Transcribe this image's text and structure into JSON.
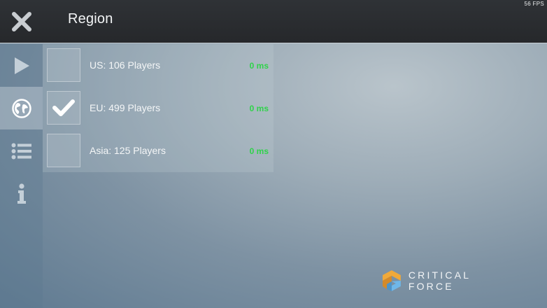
{
  "header": {
    "title": "Region",
    "fps": "56 FPS",
    "close_icon": "close-x-icon"
  },
  "sidebar": {
    "items": [
      {
        "icon": "play-icon",
        "active": false
      },
      {
        "icon": "globe-icon",
        "active": true
      },
      {
        "icon": "list-icon",
        "active": false
      },
      {
        "icon": "info-icon",
        "active": false
      }
    ]
  },
  "regions": [
    {
      "label": "US: 106 Players",
      "ping": "0 ms",
      "checked": false
    },
    {
      "label": "EU: 499 Players",
      "ping": "0 ms",
      "checked": true
    },
    {
      "label": "Asia: 125 Players",
      "ping": "0 ms",
      "checked": false
    }
  ],
  "brand": {
    "name": "CRITICAL FORCE",
    "logo_colors": [
      "#f0a93a",
      "#6fb7e8"
    ]
  },
  "colors": {
    "ping_green": "#2fd34a",
    "topbar": "#2b2d30"
  }
}
